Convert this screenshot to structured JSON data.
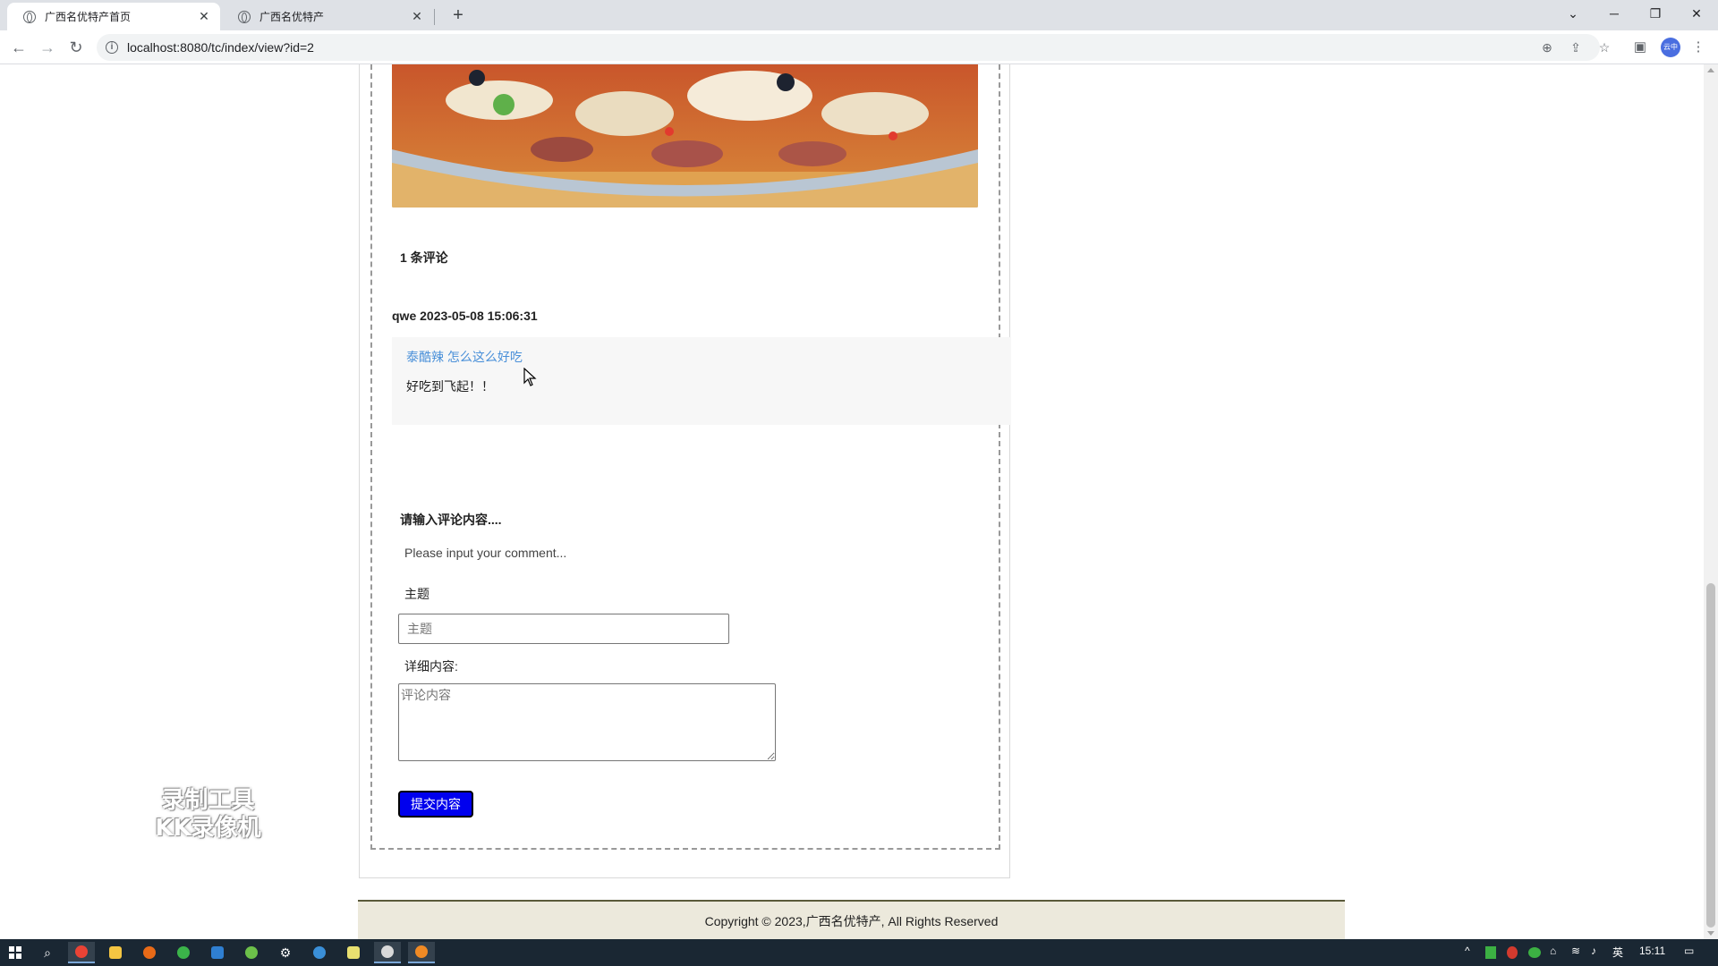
{
  "browser": {
    "tabs": [
      {
        "title": "广西名优特产首页",
        "active": true
      },
      {
        "title": "广西名优特产",
        "active": false
      }
    ],
    "url": "localhost:8080/tc/index/view?id=2",
    "profile_label": "云中"
  },
  "page": {
    "comment_count_label": "1 条评论",
    "comments": [
      {
        "meta": "qwe 2023-05-08 15:06:31",
        "title": "泰酷辣 怎么这么好吃",
        "body": "好吃到飞起！！"
      }
    ],
    "form": {
      "heading": "请输入评论内容....",
      "subheading": "Please input your comment...",
      "subject_label": "主题",
      "subject_placeholder": "主题",
      "detail_label": "详细内容:",
      "detail_placeholder": "评论内容",
      "submit_label": "提交内容"
    },
    "footer": "Copyright © 2023,广西名优特产, All Rights Reserved"
  },
  "watermark": {
    "line1": "录制工具",
    "line2": "KK录像机"
  },
  "taskbar": {
    "ime": "英",
    "time": "15:11"
  }
}
